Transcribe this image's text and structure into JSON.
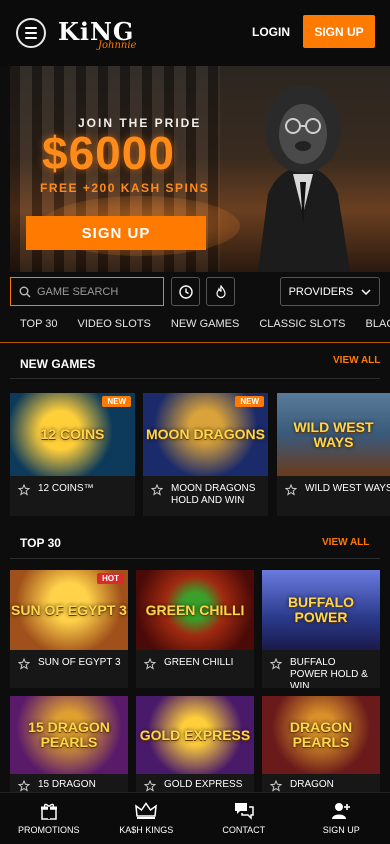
{
  "header": {
    "logo_main": "KiNG",
    "logo_sub": "Johnnie",
    "login_label": "LOGIN",
    "signup_label": "SIGN UP"
  },
  "banner": {
    "tagline": "JOIN THE PRIDE",
    "amount": "$6000",
    "offer": "FREE +200 KASH SPINS",
    "cta_label": "SIGN UP"
  },
  "search": {
    "placeholder": "GAME SEARCH"
  },
  "providers_label": "PROVIDERS",
  "tabs": [
    "TOP 30",
    "VIDEO SLOTS",
    "NEW GAMES",
    "CLASSIC SLOTS",
    "BLACKJACK"
  ],
  "new_games": {
    "title": "NEW GAMES",
    "view_all": "VIEW ALL",
    "games": [
      {
        "name": "12 COINS™",
        "art": "12 COINS",
        "badge": "NEW",
        "bg": "#0d3a5a"
      },
      {
        "name": "MOON DRAGONS HOLD AND WIN",
        "art": "MOON DRAGONS",
        "badge": "NEW",
        "bg": "#1a2a6a"
      },
      {
        "name": "WILD WEST WAYS",
        "art": "WILD WEST WAYS",
        "badge": "",
        "bg": "#3a5a7a"
      }
    ]
  },
  "top30": {
    "title": "TOP 30",
    "view_all": "VIEW ALL",
    "games": [
      {
        "name": "SUN OF EGYPT 3",
        "art": "SUN OF EGYPT 3",
        "badge": "HOT",
        "bg": "#a0501a"
      },
      {
        "name": "GREEN CHILLI",
        "art": "GREEN CHILLI",
        "badge": "",
        "bg": "#7a1a10"
      },
      {
        "name": "BUFFALO POWER HOLD & WIN",
        "art": "BUFFALO POWER",
        "badge": "",
        "bg": "#2a3a8a"
      },
      {
        "name": "15 DRAGON",
        "art": "15 DRAGON PEARLS",
        "badge": "",
        "bg": "#5a1a6a"
      },
      {
        "name": "GOLD EXPRESS",
        "art": "GOLD EXPRESS",
        "badge": "",
        "bg": "#4a1a6a"
      },
      {
        "name": "DRAGON PEARLS:",
        "art": "DRAGON PEARLS",
        "badge": "",
        "bg": "#6a1a1a"
      }
    ]
  },
  "bottom_nav": [
    {
      "label": "PROMOTIONS",
      "icon": "gift-icon"
    },
    {
      "label": "KA$H KINGS",
      "icon": "crown-icon"
    },
    {
      "label": "CONTACT",
      "icon": "chat-icon"
    },
    {
      "label": "SIGN UP",
      "icon": "add-user-icon"
    }
  ],
  "colors": {
    "accent": "#ff7a00",
    "background": "#0d0d0d",
    "card": "#171717",
    "hot": "#d92b2b"
  }
}
